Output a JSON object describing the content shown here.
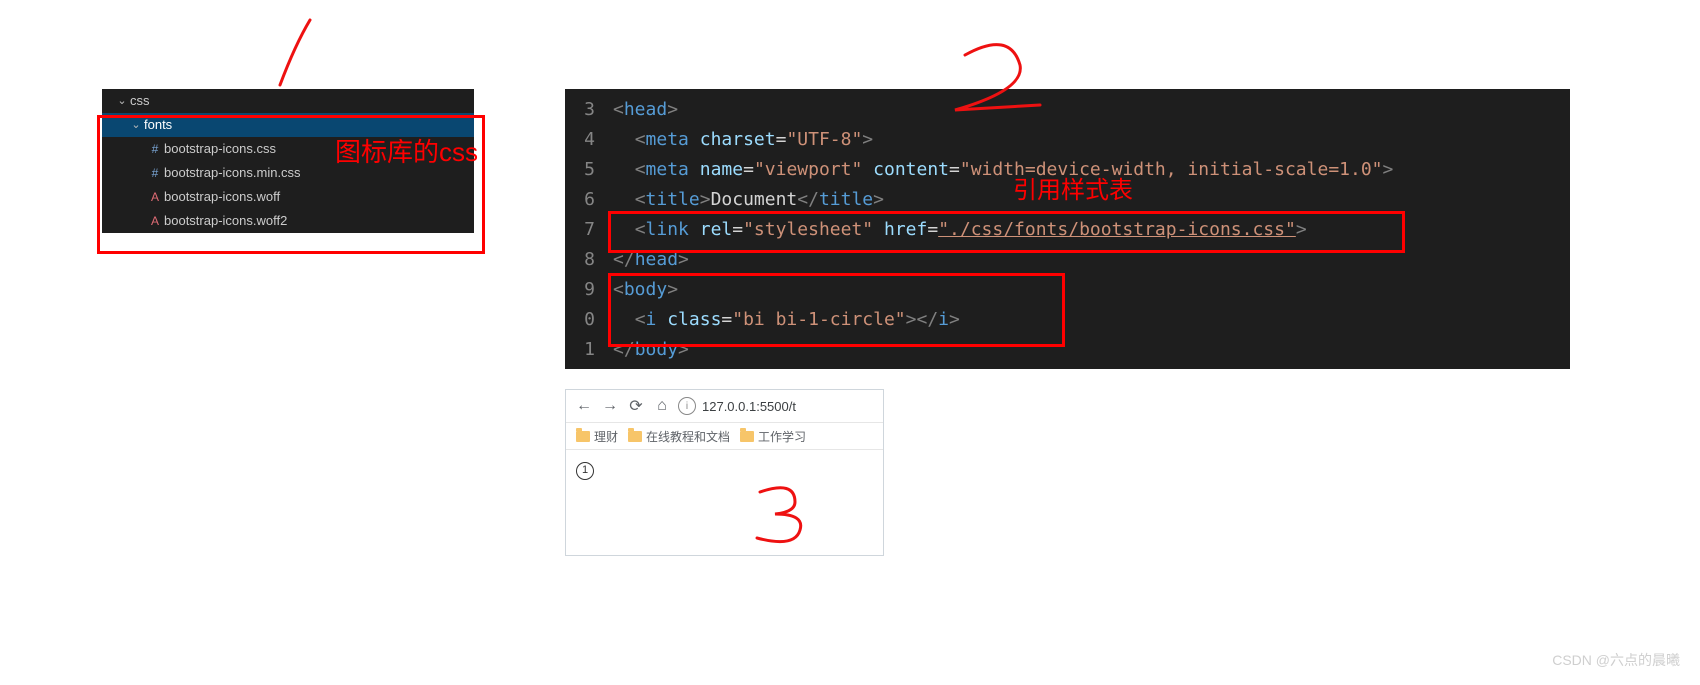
{
  "explorer": {
    "folder_css": "css",
    "folder_fonts": "fonts",
    "files": [
      "bootstrap-icons.css",
      "bootstrap-icons.min.css",
      "bootstrap-icons.woff",
      "bootstrap-icons.woff2"
    ]
  },
  "annotations": {
    "explorer_label": "图标库的css",
    "link_label": "引用样式表"
  },
  "code": {
    "line3": {
      "num": "3",
      "indent": "",
      "open": "<",
      "tag": "head",
      "close": ">"
    },
    "line4": {
      "num": "4",
      "indent": "  ",
      "open": "<",
      "tag": "meta",
      "sp": " ",
      "attr": "charset",
      "eq": "=",
      "val": "\"UTF-8\"",
      "close": ">"
    },
    "line5": {
      "num": "5",
      "indent": "  ",
      "open": "<",
      "tag": "meta",
      "sp": " ",
      "attr1": "name",
      "eq": "=",
      "val1": "\"viewport\"",
      "sp2": " ",
      "attr2": "content",
      "val2": "\"width=device-width, initial-scale=1.0\"",
      "close": ">"
    },
    "line6": {
      "num": "6",
      "indent": "  ",
      "open": "<",
      "tag": "title",
      "close": ">",
      "text": "Document",
      "open2": "</",
      "tag2": "title",
      "close2": ">"
    },
    "line7": {
      "num": "7",
      "indent": "  ",
      "open": "<",
      "tag": "link",
      "sp": " ",
      "attr1": "rel",
      "val1": "\"stylesheet\"",
      "sp2": " ",
      "attr2": "href",
      "val2": "\"./css/fonts/bootstrap-icons.css\"",
      "close": ">"
    },
    "line8": {
      "num": "8",
      "indent": "",
      "open": "</",
      "tag": "head",
      "close": ">"
    },
    "line9": {
      "num": "9",
      "indent": "",
      "open": "<",
      "tag": "body",
      "close": ">"
    },
    "line10": {
      "num": "0",
      "indent": "  ",
      "open": "<",
      "tag": "i",
      "sp": " ",
      "attr": "class",
      "eq": "=",
      "val": "\"bi bi-1-circle\"",
      "close": ">",
      "open2": "</",
      "tag2": "i",
      "close2": ">"
    },
    "line11": {
      "num": "1",
      "indent": "",
      "open": "</",
      "tag": "body",
      "close": ">"
    }
  },
  "browser": {
    "url": "127.0.0.1:5500/t",
    "bookmarks": [
      "理财",
      "在线教程和文档",
      "工作学习"
    ],
    "render_char": "1"
  },
  "watermark": "CSDN @六点的晨曦"
}
